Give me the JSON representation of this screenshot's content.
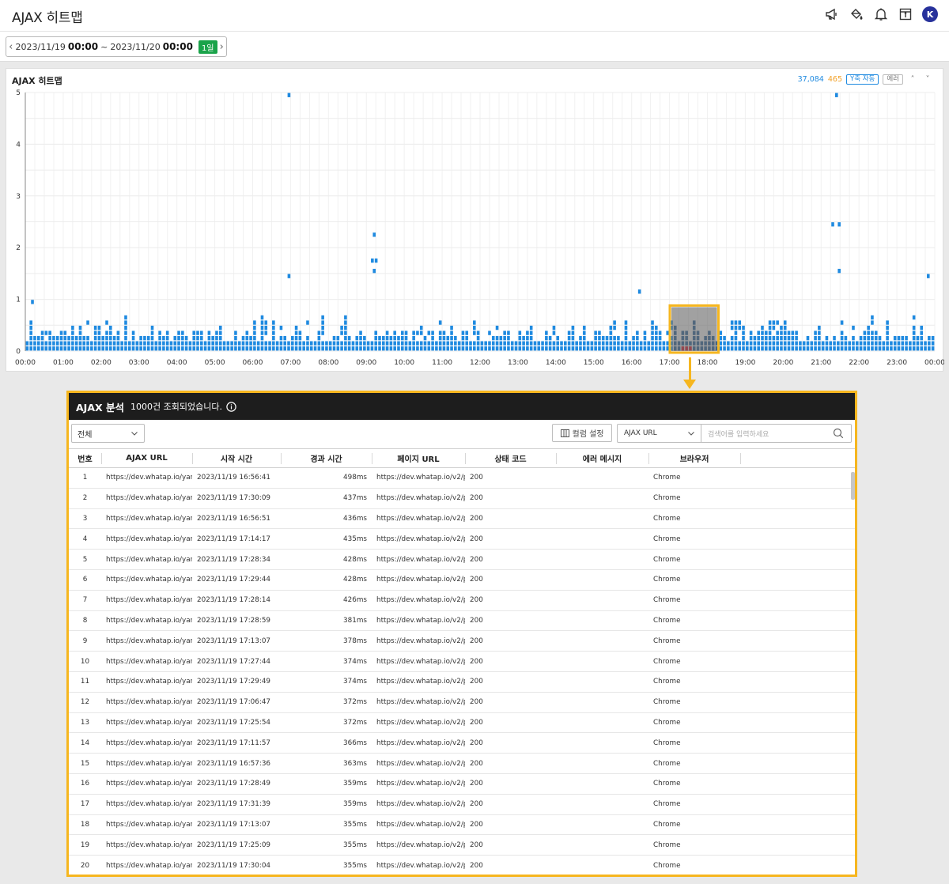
{
  "page": {
    "title": "AJAX 히트맵"
  },
  "header": {
    "icons": [
      "megaphone-icon",
      "paint-bucket-icon",
      "bell-icon",
      "calendar-icon"
    ],
    "user_initial": "K"
  },
  "datebar": {
    "start_date": "2023/11/19",
    "start_time": "00:00",
    "separator": "~",
    "end_date": "2023/11/20",
    "end_time": "00:00",
    "duration_badge": "1일"
  },
  "heatmap_panel": {
    "title": "AJAX 히트맵",
    "count_total": "37,084",
    "count_error": "465",
    "y_axis_toggle": "Y축 자동",
    "error_toggle": "에러"
  },
  "chart_data": {
    "type": "heatmap",
    "y_ticks": [
      "0",
      "1",
      "2",
      "3",
      "4",
      "5"
    ],
    "x_ticks": [
      "00:00",
      "01:00",
      "02:00",
      "03:00",
      "04:00",
      "05:00",
      "06:00",
      "07:00",
      "08:00",
      "09:00",
      "10:00",
      "11:00",
      "12:00",
      "13:00",
      "14:00",
      "15:00",
      "16:00",
      "17:00",
      "18:00",
      "19:00",
      "20:00",
      "21:00",
      "22:00",
      "23:00",
      "00:00"
    ],
    "ylim": [
      0,
      5
    ],
    "xlim_hours": [
      0,
      24
    ],
    "normal_color": "#1f8ae0",
    "selected_color": "#1c5a94",
    "error_color": "#d0021b",
    "selection_hours": [
      17.05,
      18.25
    ],
    "outliers": [
      {
        "h": 0.18,
        "v": 0.9
      },
      {
        "h": 6.95,
        "v": 4.9
      },
      {
        "h": 6.95,
        "v": 1.4
      },
      {
        "h": 9.2,
        "v": 2.2
      },
      {
        "h": 9.15,
        "v": 1.7
      },
      {
        "h": 9.25,
        "v": 1.7
      },
      {
        "h": 9.2,
        "v": 1.5
      },
      {
        "h": 16.2,
        "v": 1.1
      },
      {
        "h": 21.4,
        "v": 4.9
      },
      {
        "h": 21.3,
        "v": 2.4
      },
      {
        "h": 21.47,
        "v": 2.4
      },
      {
        "h": 21.47,
        "v": 1.5
      },
      {
        "h": 23.82,
        "v": 1.4
      }
    ]
  },
  "analysis": {
    "title": "AJAX 분석",
    "result_message": "1000건 조회되었습니다.",
    "filter_all": "전체",
    "column_settings": "컬럼 설정",
    "search_type": "AJAX URL",
    "search_placeholder": "검색어를 입력하세요",
    "columns": [
      "번호",
      "AJAX URL",
      "시작 시간",
      "경과 시간",
      "페이지 URL",
      "상태 코드",
      "에러 메시지",
      "브라우저"
    ],
    "rows": [
      {
        "no": "1",
        "url": "https://dev.whatap.io/yard/",
        "start": "2023/11/19 16:56:41",
        "dur": "498ms",
        "page": "https://dev.whatap.io/v2/p",
        "status": "200",
        "error": "",
        "browser": "Chrome"
      },
      {
        "no": "2",
        "url": "https://dev.whatap.io/yard/",
        "start": "2023/11/19 17:30:09",
        "dur": "437ms",
        "page": "https://dev.whatap.io/v2/p",
        "status": "200",
        "error": "",
        "browser": "Chrome"
      },
      {
        "no": "3",
        "url": "https://dev.whatap.io/yard/",
        "start": "2023/11/19 16:56:51",
        "dur": "436ms",
        "page": "https://dev.whatap.io/v2/p",
        "status": "200",
        "error": "",
        "browser": "Chrome"
      },
      {
        "no": "4",
        "url": "https://dev.whatap.io/yard/",
        "start": "2023/11/19 17:14:17",
        "dur": "435ms",
        "page": "https://dev.whatap.io/v2/p",
        "status": "200",
        "error": "",
        "browser": "Chrome"
      },
      {
        "no": "5",
        "url": "https://dev.whatap.io/yard/",
        "start": "2023/11/19 17:28:34",
        "dur": "428ms",
        "page": "https://dev.whatap.io/v2/p",
        "status": "200",
        "error": "",
        "browser": "Chrome"
      },
      {
        "no": "6",
        "url": "https://dev.whatap.io/yard/",
        "start": "2023/11/19 17:29:44",
        "dur": "428ms",
        "page": "https://dev.whatap.io/v2/p",
        "status": "200",
        "error": "",
        "browser": "Chrome"
      },
      {
        "no": "7",
        "url": "https://dev.whatap.io/yard/",
        "start": "2023/11/19 17:28:14",
        "dur": "426ms",
        "page": "https://dev.whatap.io/v2/p",
        "status": "200",
        "error": "",
        "browser": "Chrome"
      },
      {
        "no": "8",
        "url": "https://dev.whatap.io/yard/",
        "start": "2023/11/19 17:28:59",
        "dur": "381ms",
        "page": "https://dev.whatap.io/v2/p",
        "status": "200",
        "error": "",
        "browser": "Chrome"
      },
      {
        "no": "9",
        "url": "https://dev.whatap.io/yard/",
        "start": "2023/11/19 17:13:07",
        "dur": "378ms",
        "page": "https://dev.whatap.io/v2/p",
        "status": "200",
        "error": "",
        "browser": "Chrome"
      },
      {
        "no": "10",
        "url": "https://dev.whatap.io/yard/",
        "start": "2023/11/19 17:27:44",
        "dur": "374ms",
        "page": "https://dev.whatap.io/v2/p",
        "status": "200",
        "error": "",
        "browser": "Chrome"
      },
      {
        "no": "11",
        "url": "https://dev.whatap.io/yard/",
        "start": "2023/11/19 17:29:49",
        "dur": "374ms",
        "page": "https://dev.whatap.io/v2/p",
        "status": "200",
        "error": "",
        "browser": "Chrome"
      },
      {
        "no": "12",
        "url": "https://dev.whatap.io/yard/",
        "start": "2023/11/19 17:06:47",
        "dur": "372ms",
        "page": "https://dev.whatap.io/v2/p",
        "status": "200",
        "error": "",
        "browser": "Chrome"
      },
      {
        "no": "13",
        "url": "https://dev.whatap.io/yard/",
        "start": "2023/11/19 17:25:54",
        "dur": "372ms",
        "page": "https://dev.whatap.io/v2/p",
        "status": "200",
        "error": "",
        "browser": "Chrome"
      },
      {
        "no": "14",
        "url": "https://dev.whatap.io/yard/",
        "start": "2023/11/19 17:11:57",
        "dur": "366ms",
        "page": "https://dev.whatap.io/v2/p",
        "status": "200",
        "error": "",
        "browser": "Chrome"
      },
      {
        "no": "15",
        "url": "https://dev.whatap.io/yard/",
        "start": "2023/11/19 16:57:36",
        "dur": "363ms",
        "page": "https://dev.whatap.io/v2/p",
        "status": "200",
        "error": "",
        "browser": "Chrome"
      },
      {
        "no": "16",
        "url": "https://dev.whatap.io/yard/",
        "start": "2023/11/19 17:28:49",
        "dur": "359ms",
        "page": "https://dev.whatap.io/v2/p",
        "status": "200",
        "error": "",
        "browser": "Chrome"
      },
      {
        "no": "17",
        "url": "https://dev.whatap.io/yard/",
        "start": "2023/11/19 17:31:39",
        "dur": "359ms",
        "page": "https://dev.whatap.io/v2/p",
        "status": "200",
        "error": "",
        "browser": "Chrome"
      },
      {
        "no": "18",
        "url": "https://dev.whatap.io/yard/",
        "start": "2023/11/19 17:13:07",
        "dur": "355ms",
        "page": "https://dev.whatap.io/v2/p",
        "status": "200",
        "error": "",
        "browser": "Chrome"
      },
      {
        "no": "19",
        "url": "https://dev.whatap.io/yard/",
        "start": "2023/11/19 17:25:09",
        "dur": "355ms",
        "page": "https://dev.whatap.io/v2/p",
        "status": "200",
        "error": "",
        "browser": "Chrome"
      },
      {
        "no": "20",
        "url": "https://dev.whatap.io/yard/",
        "start": "2023/11/19 17:30:04",
        "dur": "355ms",
        "page": "https://dev.whatap.io/v2/p",
        "status": "200",
        "error": "",
        "browser": "Chrome"
      }
    ]
  }
}
